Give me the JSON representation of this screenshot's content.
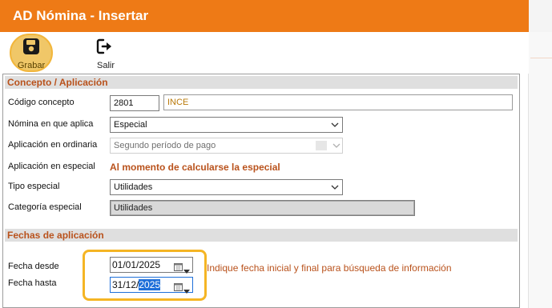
{
  "window": {
    "title": "AD Nómina - Insertar"
  },
  "toolbar": {
    "save_label": "Grabar",
    "exit_label": "Salir"
  },
  "concepto": {
    "header": "Concepto / Aplicación",
    "codigo_label": "Código concepto",
    "codigo_value": "2801",
    "descripcion_value": "INCE",
    "nomina_label": "Nómina en que aplica",
    "nomina_value": "Especial",
    "ordinaria_label": "Aplicación en ordinaria",
    "ordinaria_value": "Segundo período de pago",
    "especial_label": "Aplicación en especial",
    "especial_value": "Al momento de calcularse la especial",
    "tipo_label": "Tipo especial",
    "tipo_value": "Utilidades",
    "categoria_label": "Categoría especial",
    "categoria_value": "Utilidades"
  },
  "fechas": {
    "header": "Fechas de aplicación",
    "desde_label": "Fecha desde",
    "desde_value": "01/01/2025",
    "hasta_label": "Fecha hasta",
    "hasta_prefix": "31/12/",
    "hasta_selected": "2025",
    "hint": "Indique fecha inicial y  final para búsqueda de información"
  },
  "colors": {
    "titlebar": "#ee7a16",
    "accent_text": "#b9521c",
    "highlight": "#f5b524",
    "selection": "#1e6fd9"
  },
  "icons": {
    "save": "floppy-disk-icon",
    "exit": "exit-icon",
    "calendar": "calendar-icon",
    "dropdown": "chevron-down-icon"
  }
}
